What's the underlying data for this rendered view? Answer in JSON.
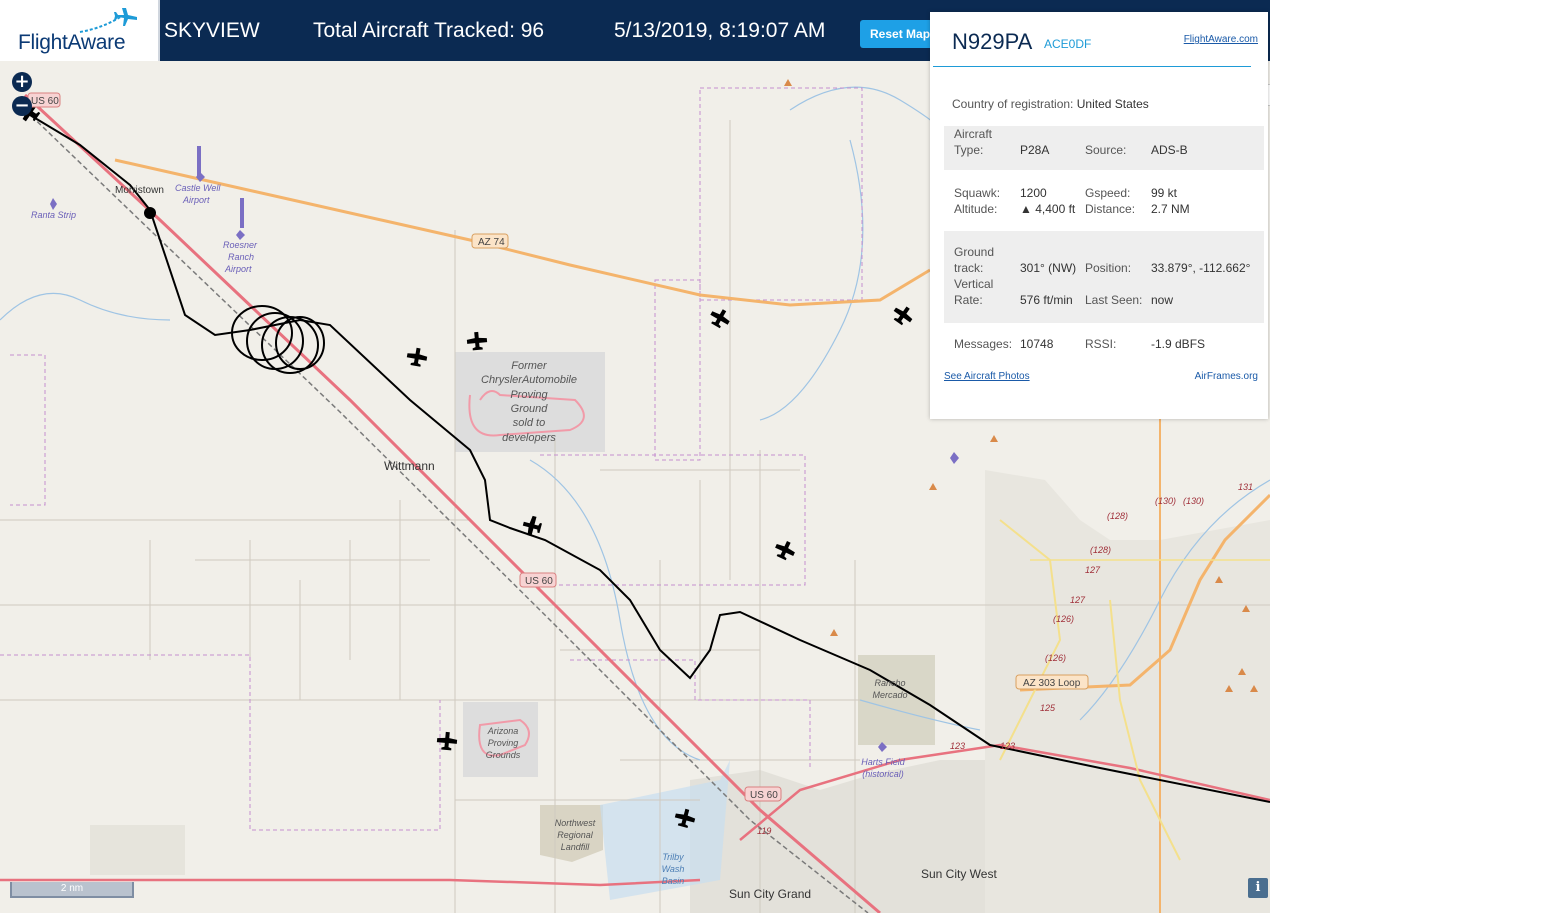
{
  "header": {
    "logo_text": "FlightAware",
    "site_name": "SKYVIEW",
    "total_tracked": "Total Aircraft Tracked: 96",
    "datetime": "5/13/2019, 8:19:07 AM",
    "reset_label": "Reset Map"
  },
  "map": {
    "zoom_in": "+",
    "zoom_out": "−",
    "scale": "2 nm",
    "info": "i",
    "place_labels": {
      "morristown": "Morristown",
      "castle_well_1": "Castle Well",
      "castle_well_2": "Airport",
      "ranta": "Ranta Strip",
      "roesner_1": "Roesner",
      "roesner_2": "Ranch",
      "roesner_3": "Airport",
      "wittmann": "Wittmann",
      "proving_1": "Former",
      "proving_2": "ChryslerAutomobile",
      "proving_3": "Proving",
      "proving_4": "Ground",
      "proving_5": "sold to",
      "proving_6": "developers",
      "az_proving_1": "Arizona",
      "az_proving_2": "Proving",
      "az_proving_3": "Grounds",
      "landfill_1": "Northwest",
      "landfill_2": "Regional",
      "landfill_3": "Landfill",
      "trilby_1": "Trilby",
      "trilby_2": "Wash",
      "trilby_3": "Basin",
      "sun_city_grand": "Sun City Grand",
      "sun_city_west": "Sun City West",
      "rancho_1": "Rancho",
      "rancho_2": "Mercado",
      "harts_1": "Harts Field",
      "harts_2": "(historical)"
    },
    "road_labels": {
      "us60_a": "US 60",
      "us60_b": "US 60",
      "us60_c": "US 60",
      "az74": "AZ 74",
      "az303": "AZ 303 Loop",
      "r130a": "(130)",
      "r130b": "(130)",
      "r131": "131",
      "r128a": "(128)",
      "r128b": "(128)",
      "r127a": "127",
      "r127b": "127",
      "r126a": "(126)",
      "r126b": "(126)",
      "r125": "125",
      "r123a": "123",
      "r123b": "123",
      "r119": "119"
    }
  },
  "panel": {
    "registration": "N929PA",
    "hex": "ACE0DF",
    "fa_link": "FlightAware.com",
    "country_label": "Country of registration:",
    "country_value": "United States",
    "type_label_1": "Aircraft",
    "type_label_2": "Type:",
    "type_value": "P28A",
    "source_label": "Source:",
    "source_value": "ADS-B",
    "squawk_label": "Squawk:",
    "squawk_value": "1200",
    "gspeed_label": "Gspeed:",
    "gspeed_value": "99 kt",
    "altitude_label": "Altitude:",
    "altitude_value": "▲ 4,400 ft",
    "distance_label": "Distance:",
    "distance_value": "2.7 NM",
    "track_label_1": "Ground",
    "track_label_2": "track:",
    "track_value": "301° (NW)",
    "position_label": "Position:",
    "position_value": "33.879°, -112.662°",
    "vrate_label_1": "Vertical",
    "vrate_label_2": "Rate:",
    "vrate_value": "576 ft/min",
    "lastseen_label": "Last Seen:",
    "lastseen_value": "now",
    "messages_label": "Messages:",
    "messages_value": "10748",
    "rssi_label": "RSSI:",
    "rssi_value": "-1.9 dBFS",
    "photos_link": "See Aircraft Photos",
    "airframes_link": "AirFrames.org"
  },
  "colors": {
    "header_bg": "#0b2a52",
    "accent": "#1e9bd7",
    "map_bg": "#f1efe9",
    "highway": "#f4b46c",
    "major_road": "#e8727f",
    "track": "#000000"
  }
}
